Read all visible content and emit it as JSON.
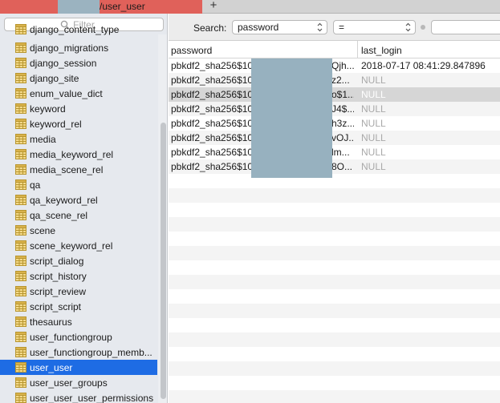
{
  "tab": {
    "title": "/user_user"
  },
  "sidebar": {
    "filter_placeholder": "Filter",
    "partial_top_label": "django_content_type",
    "tables": [
      "django_migrations",
      "django_session",
      "django_site",
      "enum_value_dict",
      "keyword",
      "keyword_rel",
      "media",
      "media_keyword_rel",
      "media_scene_rel",
      "qa",
      "qa_keyword_rel",
      "qa_scene_rel",
      "scene",
      "scene_keyword_rel",
      "script_dialog",
      "script_history",
      "script_review",
      "script_script",
      "thesaurus",
      "user_functiongroup",
      "user_functiongroup_memb...",
      "user_user",
      "user_user_groups",
      "user_user_user_permissions"
    ],
    "selected": "user_user"
  },
  "search": {
    "label": "Search:",
    "field": "password",
    "operator": "=",
    "value": ""
  },
  "grid": {
    "columns": [
      "password",
      "last_login"
    ],
    "rows": [
      {
        "pw_prefix": "pbkdf2_sha256$10",
        "pw_suffix": "Qjh...",
        "last_login": "2018-07-17 08:41:29.847896"
      },
      {
        "pw_prefix": "pbkdf2_sha256$10",
        "pw_suffix": "z2...",
        "last_login": "NULL"
      },
      {
        "pw_prefix": "pbkdf2_sha256$10",
        "pw_suffix": "o$1...",
        "last_login": "NULL"
      },
      {
        "pw_prefix": "pbkdf2_sha256$10",
        "pw_suffix": "J4$...",
        "last_login": "NULL"
      },
      {
        "pw_prefix": "pbkdf2_sha256$10",
        "pw_suffix": "h3z...",
        "last_login": "NULL"
      },
      {
        "pw_prefix": "pbkdf2_sha256$10",
        "pw_suffix": "vOJ...",
        "last_login": "NULL"
      },
      {
        "pw_prefix": "pbkdf2_sha256$10",
        "pw_suffix": "lm...",
        "last_login": "NULL"
      },
      {
        "pw_prefix": "pbkdf2_sha256$10",
        "pw_suffix": "8O...",
        "last_login": "NULL"
      }
    ],
    "highlighted_row": 3
  },
  "colors": {
    "tab_active": "#e0615a",
    "selection": "#1e6ce4",
    "redaction": "#97b1bf",
    "null_text": "#a9a9a9"
  },
  "icons": {
    "table": "table-icon",
    "filter": "search-icon",
    "add_tab": "plus-icon",
    "clear": "clear-icon"
  }
}
